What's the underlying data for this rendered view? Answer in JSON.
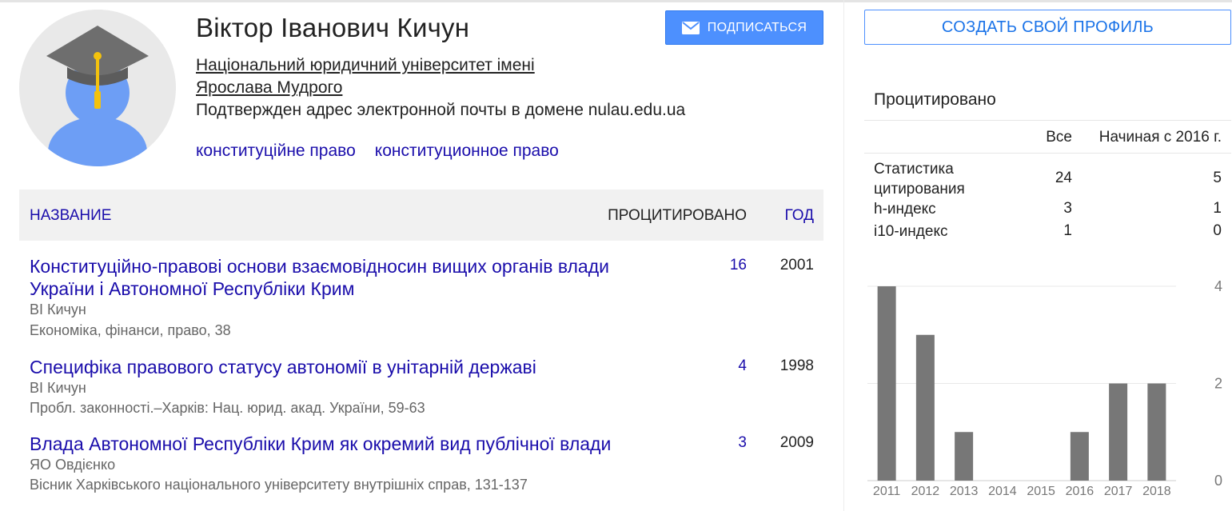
{
  "profile": {
    "name": "Віктор Іванович Кичун",
    "affiliation_line1": "Національний юридичний університет імені",
    "affiliation_line2": "Ярослава Мудрого",
    "email_verified": "Подтвержден адрес электронной почты в домене nulau.edu.ua",
    "interests": [
      "конституційне право",
      "конституционное право"
    ],
    "follow_label": "ПОДПИСАТЬСЯ",
    "follow_icon": "envelope-icon",
    "avatar_icon": "graduation-cap-avatar"
  },
  "table": {
    "header": {
      "title": "НАЗВАНИЕ",
      "cited": "ПРОЦИТИРОВАНО",
      "year": "ГОД"
    },
    "rows": [
      {
        "title": "Конституційно-правові основи взаємовідносин вищих органів влади України і Автономної Республіки Крим",
        "authors": "ВІ Кичун",
        "venue": "Економіка, фінанси, право, 38",
        "cited": "16",
        "year": "2001"
      },
      {
        "title": "Специфіка правового статусу автономії в унітарній державі",
        "authors": "ВІ Кичун",
        "venue": "Пробл. законності.–Харків: Нац. юрид. акад. України, 59-63",
        "cited": "4",
        "year": "1998"
      },
      {
        "title": "Влада Автономної Республіки Крим як окремий вид публічної влади",
        "authors": "ЯО Овдієнко",
        "venue": "Вісник Харківського національного університету внутрішніх справ, 131-137",
        "cited": "3",
        "year": "2009"
      }
    ]
  },
  "sidebar": {
    "create_profile_label": "СОЗДАТЬ СВОЙ ПРОФИЛЬ",
    "cited_heading": "Процитировано",
    "col_all": "Все",
    "col_since": "Начиная с 2016 г.",
    "stats": [
      {
        "label": "Статистика цитирования",
        "all": "24",
        "since": "5"
      },
      {
        "label": "h-индекс",
        "all": "3",
        "since": "1"
      },
      {
        "label": "i10-индекс",
        "all": "1",
        "since": "0"
      }
    ]
  },
  "chart_data": {
    "type": "bar",
    "categories": [
      "2011",
      "2012",
      "2013",
      "2014",
      "2015",
      "2016",
      "2017",
      "2018"
    ],
    "values": [
      4,
      3,
      1,
      0,
      0,
      1,
      2,
      2
    ],
    "ylim": [
      0,
      4
    ],
    "yticks": [
      "4",
      "2",
      "0"
    ],
    "grid": true,
    "bar_color": "#777777",
    "axis_position": "right"
  },
  "colors": {
    "link": "#1a0dab",
    "button_blue": "#4d90fe",
    "header_bg": "#f1f1f1"
  }
}
